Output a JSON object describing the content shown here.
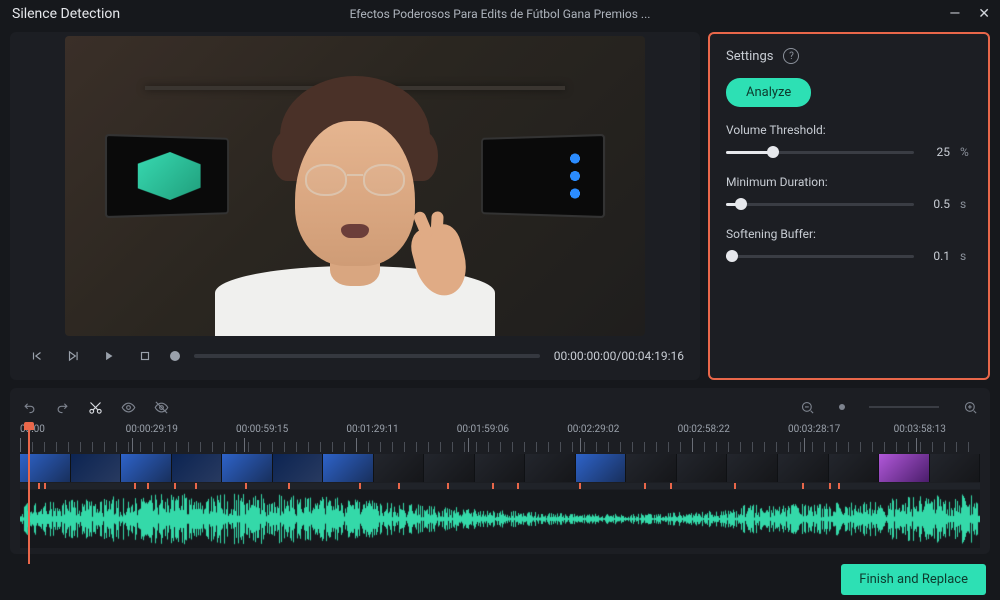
{
  "window": {
    "title": "Silence Detection",
    "filename": "Efectos Poderosos Para Edits de Fútbol   Gana Premios ..."
  },
  "transport": {
    "timecode": "00:00:00:00/00:04:19:16"
  },
  "settings": {
    "header": "Settings",
    "analyze_label": "Analyze",
    "volume_threshold": {
      "label": "Volume Threshold:",
      "value": "25",
      "unit": "%",
      "pct": 25
    },
    "minimum_duration": {
      "label": "Minimum Duration:",
      "value": "0.5",
      "unit": "s",
      "pct": 8
    },
    "softening_buffer": {
      "label": "Softening Buffer:",
      "value": "0.1",
      "unit": "s",
      "pct": 3
    }
  },
  "ruler": {
    "labels": [
      {
        "text": "00:00",
        "pct": 0
      },
      {
        "text": "00:00:29:19",
        "pct": 11
      },
      {
        "text": "00:00:59:15",
        "pct": 22.5
      },
      {
        "text": "00:01:29:11",
        "pct": 34
      },
      {
        "text": "00:01:59:06",
        "pct": 45.5
      },
      {
        "text": "00:02:29:02",
        "pct": 57
      },
      {
        "text": "00:02:58:22",
        "pct": 68.5
      },
      {
        "text": "00:03:28:17",
        "pct": 80
      },
      {
        "text": "00:03:58:13",
        "pct": 91
      }
    ]
  },
  "footer": {
    "finish_label": "Finish and Replace"
  }
}
